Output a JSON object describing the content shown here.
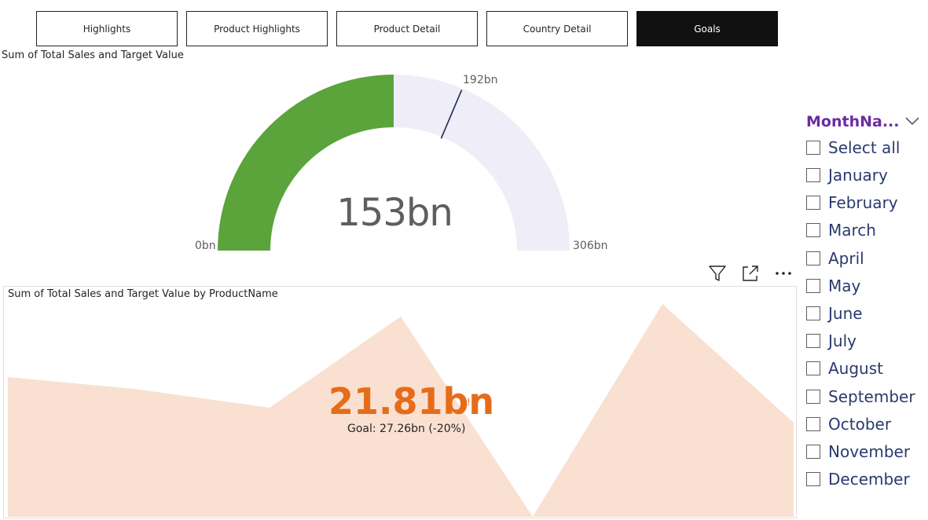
{
  "nav": {
    "buttons": [
      "Highlights",
      "Product Highlights",
      "Product Detail",
      "Country Detail",
      "Goals"
    ]
  },
  "gauge": {
    "title": "Sum of Total Sales and Target Value",
    "min_label": "0bn",
    "max_label": "306bn",
    "target_label": "192bn",
    "value_label": "153bn",
    "value": 153,
    "target": 192,
    "min": 0,
    "max": 306,
    "fill_color": "#5ba33b",
    "track_color": "#efedf8",
    "target_color": "#1b2a4e"
  },
  "kpi": {
    "title": "Sum of Total Sales and Target Value by ProductName",
    "value": "21.81bn",
    "alert": "!",
    "goal_text": "Goal: 27.26bn (-20%)",
    "value_color": "#e66c19",
    "area_color": "#f9e0d1"
  },
  "visual_icons": [
    "filter-icon",
    "focus-mode-icon",
    "more-options-icon"
  ],
  "slicer": {
    "header": "MonthNa...",
    "items": [
      "Select all",
      "January",
      "February",
      "March",
      "April",
      "May",
      "June",
      "July",
      "August",
      "September",
      "October",
      "November",
      "December"
    ]
  }
}
